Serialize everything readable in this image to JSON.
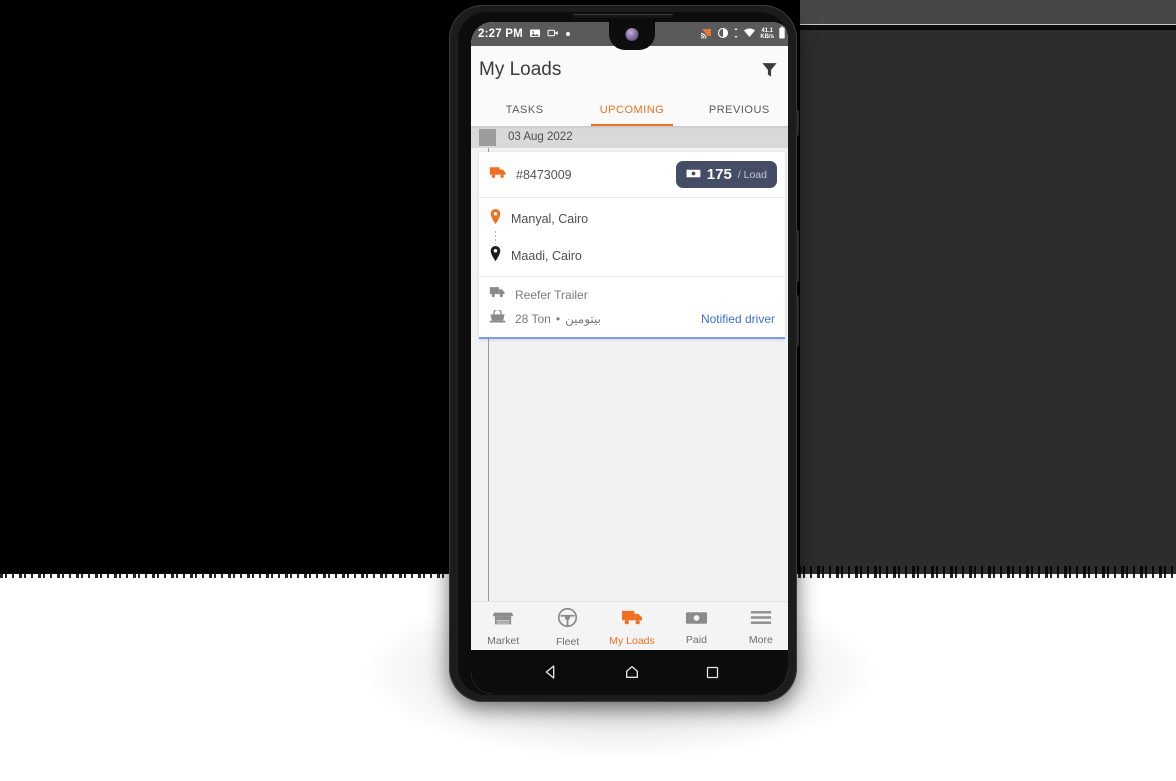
{
  "statusbar": {
    "time": "2:27 PM",
    "left_icons": [
      "image-icon",
      "video-camera-icon",
      "dot-icon"
    ],
    "right_icons": [
      "cast-icon",
      "brightness-icon",
      "data-transfer-icon",
      "wifi-icon",
      "battery-icon"
    ],
    "network_speed_value": "41.1",
    "network_speed_unit": "KB/s"
  },
  "appbar": {
    "title": "My Loads",
    "filter_icon": "filter-icon"
  },
  "tabs": [
    {
      "label": "TASKS",
      "active": false
    },
    {
      "label": "UPCOMING",
      "active": true
    },
    {
      "label": "PREVIOUS",
      "active": false
    }
  ],
  "date_group": {
    "label": "03 Aug 2022"
  },
  "load_card": {
    "truck_icon": "truck-icon",
    "load_id": "#8473009",
    "price": {
      "money_icon": "money-icon",
      "value": "175",
      "unit": "/ Load"
    },
    "origin": {
      "icon": "map-pin-orange-icon",
      "label": "Manyal, Cairo"
    },
    "destination": {
      "icon": "map-pin-black-icon",
      "label": "Maadi, Cairo"
    },
    "trailer": {
      "icon": "trailer-truck-icon",
      "label": "Reefer Trailer"
    },
    "cargo": {
      "icon": "weight-icon",
      "weight": "28 Ton",
      "separator": "•",
      "type_ar": "بيتومين"
    },
    "status_link": "Notified driver"
  },
  "bottom_nav": [
    {
      "label": "Market",
      "icon": "store-icon",
      "active": false
    },
    {
      "label": "Fleet",
      "icon": "steering-wheel-icon",
      "active": false
    },
    {
      "label": "My Loads",
      "icon": "truck-icon",
      "active": true
    },
    {
      "label": "Paid",
      "icon": "money-icon",
      "active": false
    },
    {
      "label": "More",
      "icon": "hamburger-menu-icon",
      "active": false
    }
  ],
  "android_nav": [
    {
      "icon": "back-triangle-icon"
    },
    {
      "icon": "home-icon"
    },
    {
      "icon": "recents-square-icon"
    }
  ],
  "colors": {
    "accent_orange": "#ed7024",
    "link_blue": "#3f6fd8",
    "price_badge_bg": "#454d66",
    "card_underline": "#7a9fe0"
  }
}
